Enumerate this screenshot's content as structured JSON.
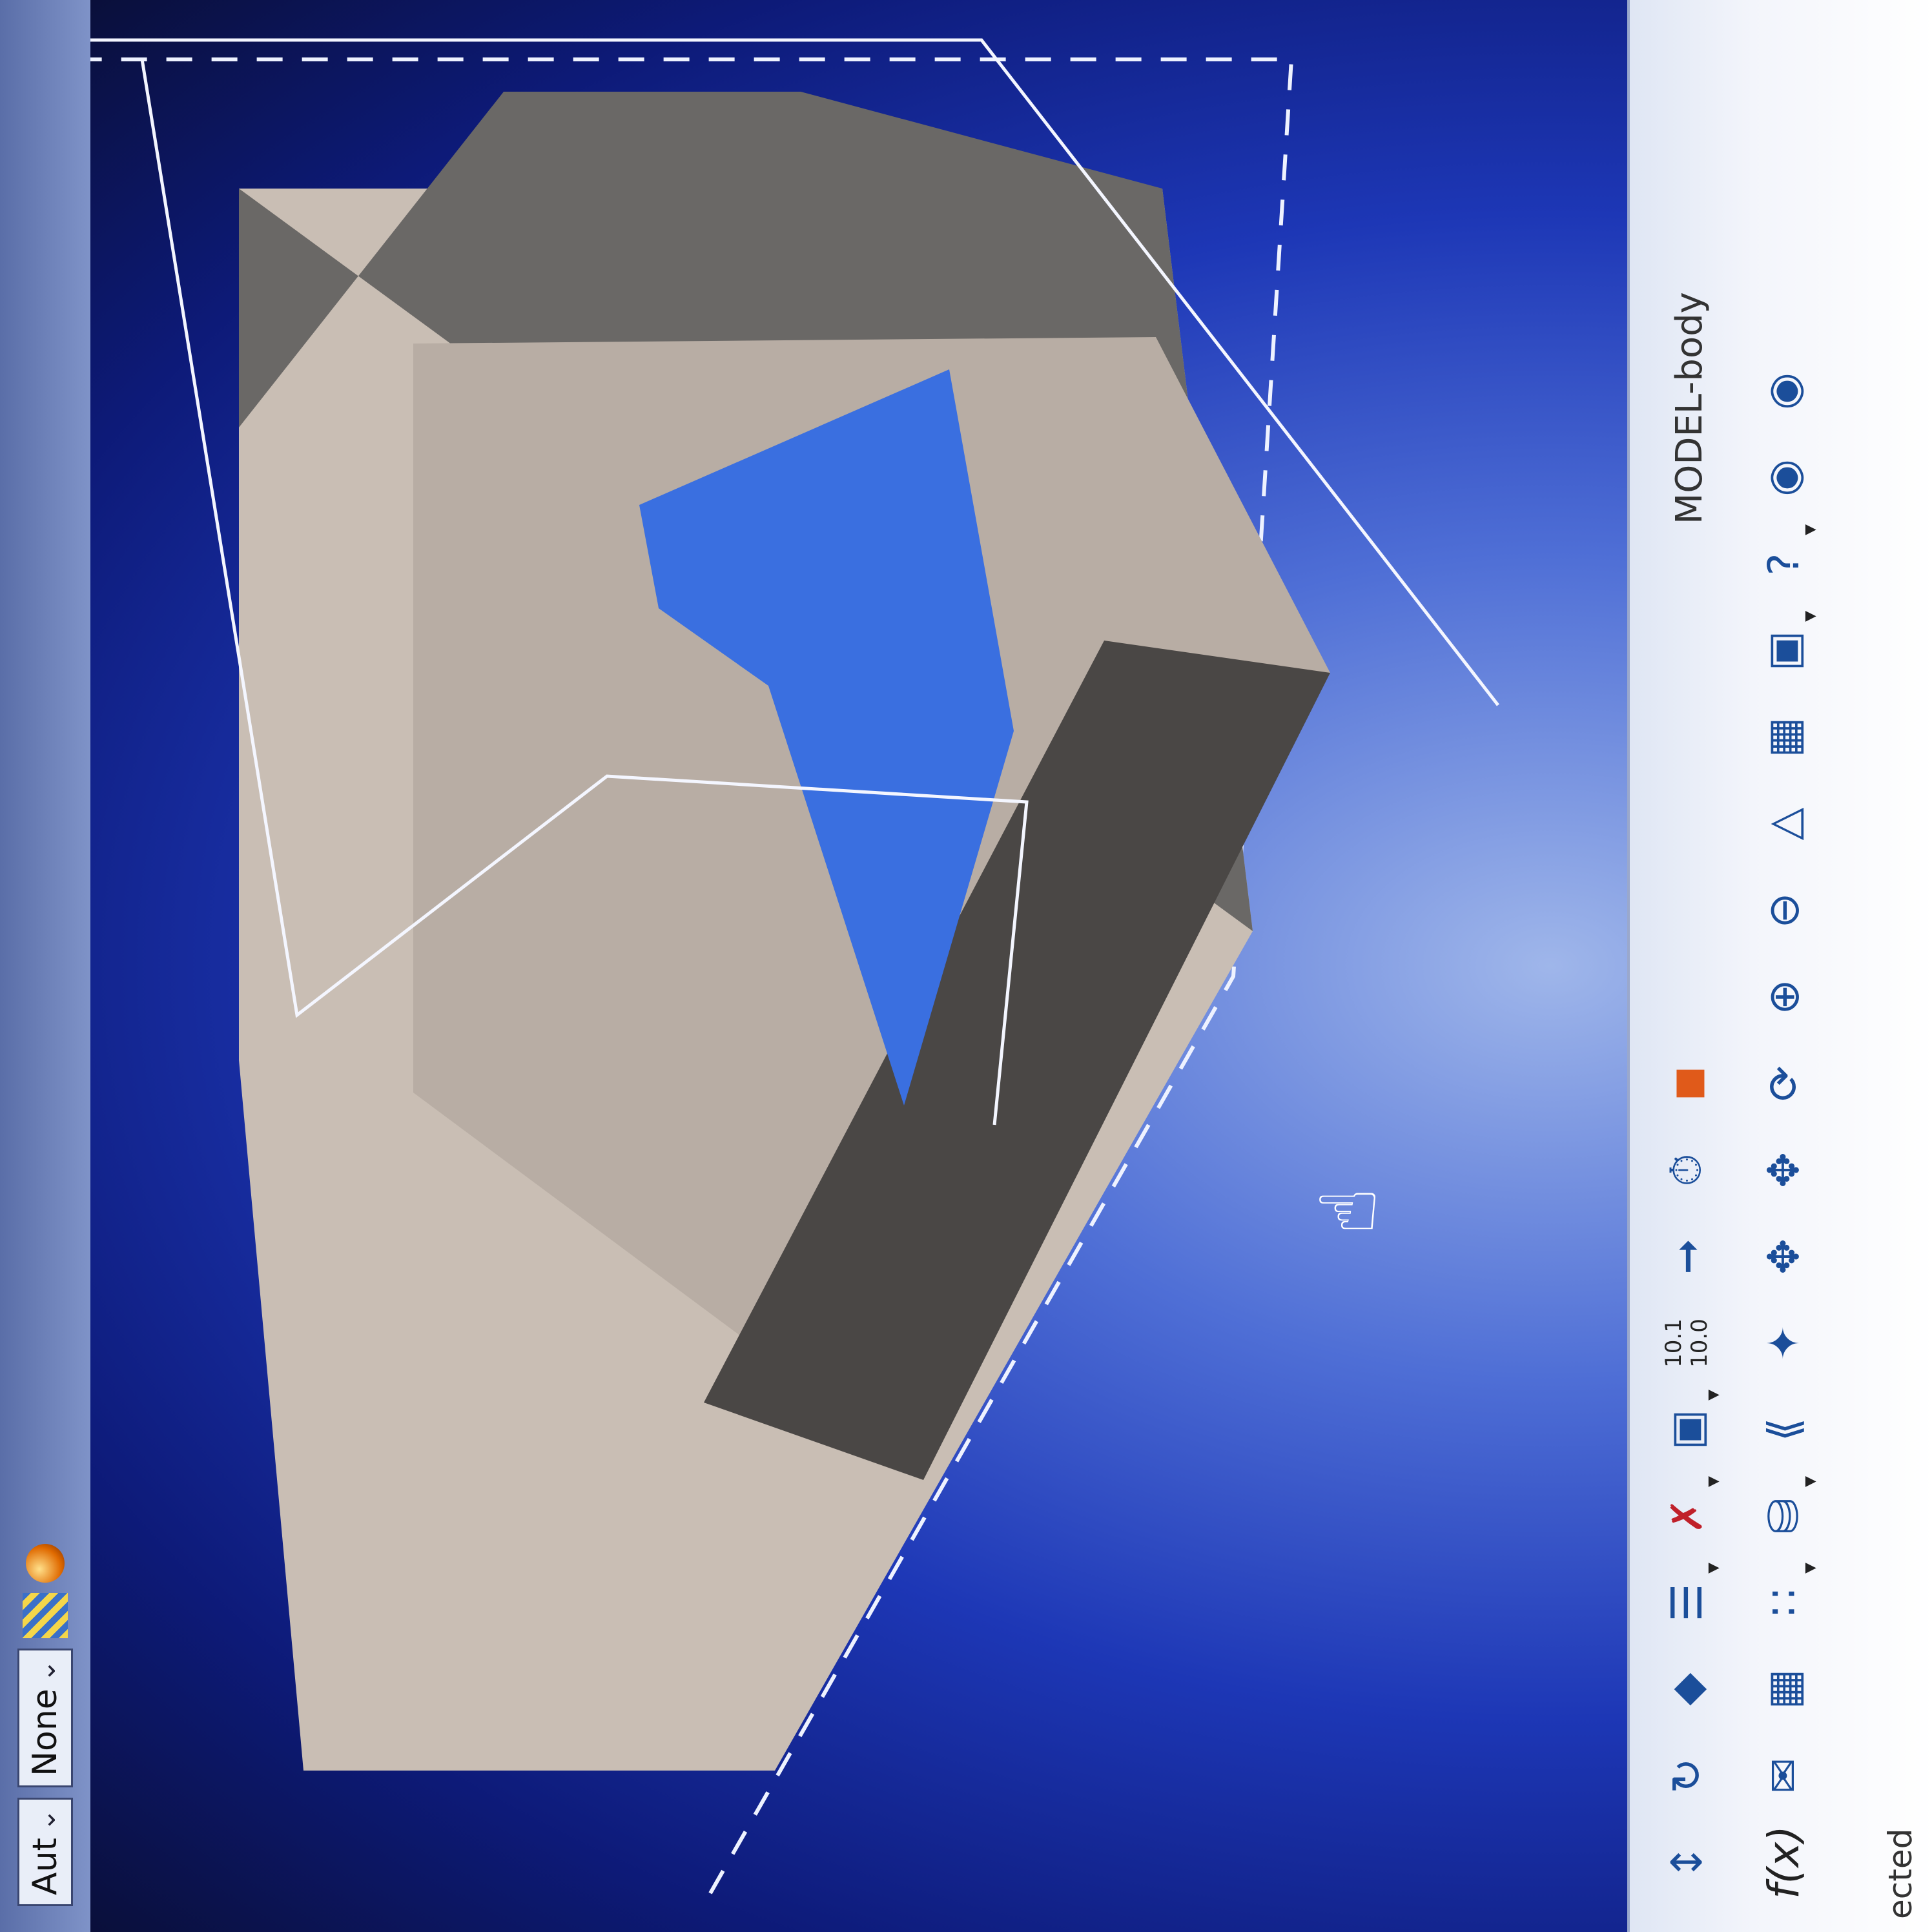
{
  "toolbar_top": {
    "combo_1": {
      "value": "Aut"
    },
    "combo_2": {
      "value": "None"
    },
    "icons": [
      "sphere-icon",
      "stripes-icon"
    ]
  },
  "toolbar": {
    "model_label": "MODEL-body",
    "scale_label_top": "10.1",
    "scale_label_bottom": "10.0",
    "formula_label": "f(x)",
    "row1_icons": [
      "measure-icon",
      "refresh-icon",
      "body-icon",
      "list-icon",
      "snap-icon",
      "cube-icon",
      "scale-icon",
      "axis-icon",
      "clock-icon",
      "orange-shape-icon"
    ],
    "row2_icons": [
      "formula-icon",
      "comment-icon",
      "table-icon",
      "grid-pattern-icon",
      "disk-icon",
      "bracket-icon",
      "star-icon",
      "fit-all-icon",
      "pan-icon",
      "rotate-icon",
      "zoom-in-icon",
      "zoom-out-icon",
      "normal-view-icon",
      "multi-view-icon",
      "cube-view-icon",
      "help-icon",
      "render-icon",
      "shading-icon",
      "print-icon"
    ]
  },
  "status": {
    "text": "ected"
  },
  "colors": {
    "viewport_bg": "#1d37b6",
    "part_top": "#c7bcb2",
    "part_side": "#6a6866",
    "accent_blue": "#3a6fe0"
  }
}
